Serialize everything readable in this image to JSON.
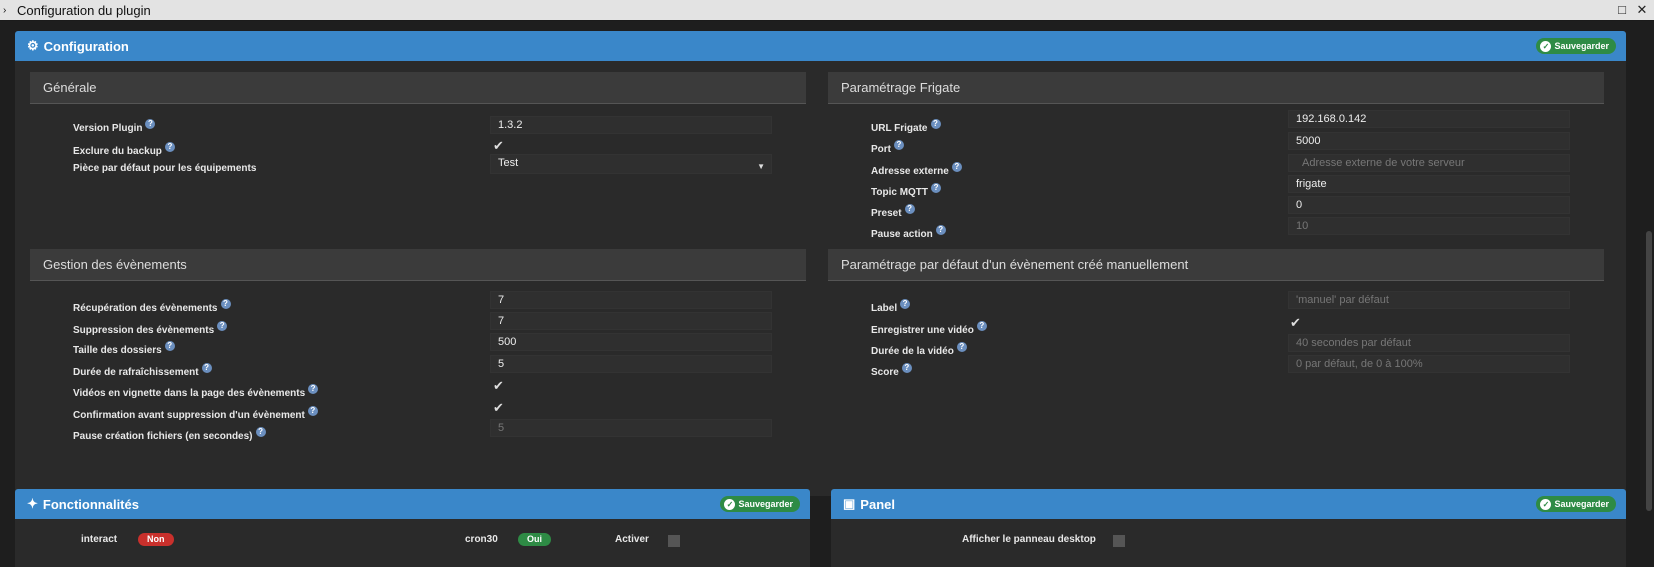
{
  "window": {
    "title": "Configuration du plugin"
  },
  "config_panel": {
    "title": "Configuration",
    "save_label": "Sauvegarder"
  },
  "generale": {
    "title": "Générale",
    "version_label": "Version Plugin",
    "version_value": "1.3.2",
    "exclude_label": "Exclure du backup",
    "exclude_checked": true,
    "room_label": "Pièce par défaut pour les équipements",
    "room_value": "Test"
  },
  "frigate": {
    "title": "Paramétrage Frigate",
    "url_label": "URL Frigate",
    "url_value": "192.168.0.142",
    "port_label": "Port",
    "port_value": "5000",
    "ext_label": "Adresse externe",
    "ext_placeholder": "Adresse externe de votre serveur",
    "mqtt_label": "Topic MQTT",
    "mqtt_value": "frigate",
    "preset_label": "Preset",
    "preset_value": "0",
    "pause_label": "Pause action",
    "pause_placeholder": "10"
  },
  "events": {
    "title": "Gestion des évènements",
    "recup_label": "Récupération des évènements",
    "recup_value": "7",
    "suppr_label": "Suppression des évènements",
    "suppr_value": "7",
    "taille_label": "Taille des dossiers",
    "taille_value": "500",
    "refresh_label": "Durée de rafraîchissement",
    "refresh_value": "5",
    "vignette_label": "Vidéos en vignette dans la page des évènements",
    "vignette_checked": true,
    "confirm_label": "Confirmation avant suppression d'un évènement",
    "confirm_checked": true,
    "pause_label": "Pause création fichiers (en secondes)",
    "pause_placeholder": "5"
  },
  "manual": {
    "title": "Paramétrage par défaut d'un évènement créé manuellement",
    "label_label": "Label",
    "label_placeholder": "'manuel' par défaut",
    "record_label": "Enregistrer une vidéo",
    "record_checked": true,
    "duration_label": "Durée de la vidéo",
    "duration_placeholder": "40 secondes par défaut",
    "score_label": "Score",
    "score_placeholder": "0 par défaut, de 0 à 100%"
  },
  "features": {
    "title": "Fonctionnalités",
    "save_label": "Sauvegarder",
    "interact_label": "interact",
    "interact_status": "Non",
    "cron_label": "cron30",
    "cron_status": "Oui",
    "activer_label": "Activer"
  },
  "panel": {
    "title": "Panel",
    "save_label": "Sauvegarder",
    "desktop_label": "Afficher le panneau desktop"
  },
  "colors": {
    "accent": "#3a87c9",
    "success": "#2e8b45",
    "danger": "#c9302c"
  },
  "icons": [
    "chevron-right-icon",
    "maximize-icon",
    "close-icon",
    "cogs-icon",
    "puzzle-icon",
    "monitor-icon",
    "check-circle-icon",
    "help-icon",
    "checkmark-icon"
  ]
}
